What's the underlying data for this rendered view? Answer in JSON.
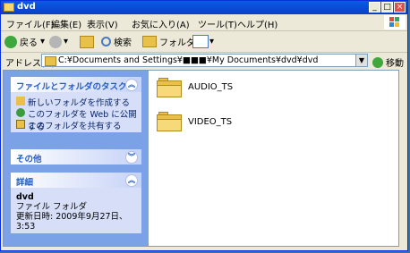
{
  "window": {
    "title": "dvd"
  },
  "menu": [
    "ファイル(F)",
    "編集(E)",
    "表示(V)",
    "お気に入り(A)",
    "ツール(T)",
    "ヘルプ(H)"
  ],
  "toolbar": {
    "back": "戻る",
    "search": "検索",
    "folders": "フォルダ"
  },
  "address": {
    "label": "アドレス(D)",
    "value": "C:¥Documents and Settings¥■■■¥My Documents¥dvd¥dvd",
    "go": "移動"
  },
  "sidebar": {
    "tasks": {
      "title": "ファイルとフォルダのタスク",
      "items": [
        "新しいフォルダを作成する",
        "このフォルダを Web に公開する",
        "このフォルダを共有する"
      ]
    },
    "other": {
      "title": "その他"
    },
    "details": {
      "title": "詳細",
      "name": "dvd",
      "type": "ファイル フォルダ",
      "modified": "更新日時: 2009年9月27日、3:53"
    }
  },
  "files": [
    {
      "name": "AUDIO_TS"
    },
    {
      "name": "VIDEO_TS"
    }
  ]
}
